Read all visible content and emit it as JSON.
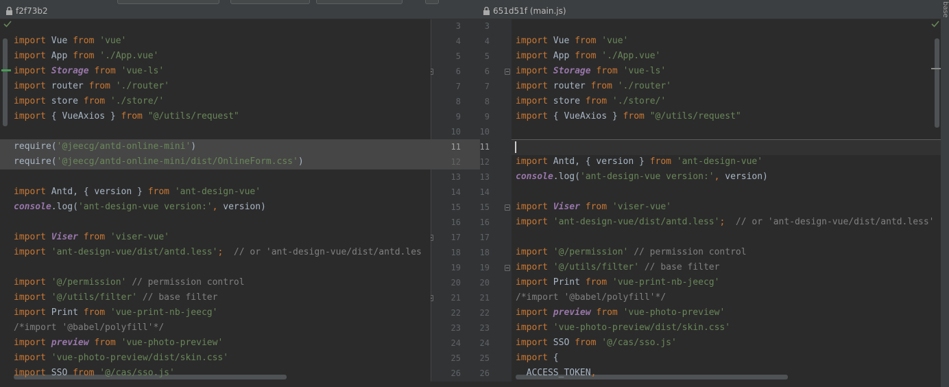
{
  "header": {
    "left_revision": "f2f73b2",
    "right_revision": "651d51f (main.js)",
    "right_edge_label": "base"
  },
  "colors": {
    "keyword": "#cc7832",
    "string": "#6a8759",
    "class": "#9876aa",
    "comment": "#808080",
    "check": "#6a8759",
    "changed_marker": "#499c54"
  },
  "icons": {
    "lock": "lock-icon",
    "check": "check-icon",
    "fold": "fold-marker-icon"
  },
  "left_lines": [
    [
      {
        "t": "kw",
        "v": "import"
      },
      {
        "t": "plain",
        "v": " Vue "
      },
      {
        "t": "kw",
        "v": "from"
      },
      {
        "t": "plain",
        "v": " "
      },
      {
        "t": "str",
        "v": "'vue'"
      }
    ],
    [
      {
        "t": "kw",
        "v": "import"
      },
      {
        "t": "plain",
        "v": " App "
      },
      {
        "t": "kw",
        "v": "from"
      },
      {
        "t": "plain",
        "v": " "
      },
      {
        "t": "str",
        "v": "'./App.vue'"
      }
    ],
    [
      {
        "t": "kw",
        "v": "import"
      },
      {
        "t": "plain",
        "v": " "
      },
      {
        "t": "cls",
        "v": "Storage"
      },
      {
        "t": "plain",
        "v": " "
      },
      {
        "t": "kw",
        "v": "from"
      },
      {
        "t": "plain",
        "v": " "
      },
      {
        "t": "str",
        "v": "'vue-ls'"
      }
    ],
    [
      {
        "t": "kw",
        "v": "import"
      },
      {
        "t": "plain",
        "v": " router "
      },
      {
        "t": "kw",
        "v": "from"
      },
      {
        "t": "plain",
        "v": " "
      },
      {
        "t": "str",
        "v": "'./router'"
      }
    ],
    [
      {
        "t": "kw",
        "v": "import"
      },
      {
        "t": "plain",
        "v": " store "
      },
      {
        "t": "kw",
        "v": "from"
      },
      {
        "t": "plain",
        "v": " "
      },
      {
        "t": "str",
        "v": "'./store/'"
      }
    ],
    [
      {
        "t": "kw",
        "v": "import"
      },
      {
        "t": "plain",
        "v": " { VueAxios } "
      },
      {
        "t": "kw",
        "v": "from"
      },
      {
        "t": "plain",
        "v": " "
      },
      {
        "t": "str",
        "v": "\"@/utils/request\""
      }
    ],
    [],
    [
      {
        "t": "plain",
        "v": "require("
      },
      {
        "t": "str",
        "v": "'@jeecg/antd-online-mini'"
      },
      {
        "t": "plain",
        "v": ")"
      }
    ],
    [
      {
        "t": "plain",
        "v": "require("
      },
      {
        "t": "str",
        "v": "'@jeecg/antd-online-mini/dist/OnlineForm.css'"
      },
      {
        "t": "plain",
        "v": ")"
      }
    ],
    [],
    [
      {
        "t": "kw",
        "v": "import"
      },
      {
        "t": "plain",
        "v": " Antd, { version } "
      },
      {
        "t": "kw",
        "v": "from"
      },
      {
        "t": "plain",
        "v": " "
      },
      {
        "t": "str",
        "v": "'ant-design-vue'"
      }
    ],
    [
      {
        "t": "cls",
        "v": "console"
      },
      {
        "t": "plain",
        "v": "."
      },
      {
        "t": "plain",
        "v": "log("
      },
      {
        "t": "str",
        "v": "'ant-design-vue version:'"
      },
      {
        "t": "kw",
        "v": ","
      },
      {
        "t": "plain",
        "v": " version)"
      }
    ],
    [],
    [
      {
        "t": "kw",
        "v": "import"
      },
      {
        "t": "plain",
        "v": " "
      },
      {
        "t": "cls",
        "v": "Viser"
      },
      {
        "t": "plain",
        "v": " "
      },
      {
        "t": "kw",
        "v": "from"
      },
      {
        "t": "plain",
        "v": " "
      },
      {
        "t": "str",
        "v": "'viser-vue'"
      }
    ],
    [
      {
        "t": "kw",
        "v": "import"
      },
      {
        "t": "plain",
        "v": " "
      },
      {
        "t": "str",
        "v": "'ant-design-vue/dist/antd.less'"
      },
      {
        "t": "kw",
        "v": ";"
      },
      {
        "t": "plain",
        "v": "  "
      },
      {
        "t": "cmt",
        "v": "// or 'ant-design-vue/dist/antd.les"
      }
    ],
    [],
    [
      {
        "t": "kw",
        "v": "import"
      },
      {
        "t": "plain",
        "v": " "
      },
      {
        "t": "str",
        "v": "'@/permission'"
      },
      {
        "t": "plain",
        "v": " "
      },
      {
        "t": "cmt",
        "v": "// permission control"
      }
    ],
    [
      {
        "t": "kw",
        "v": "import"
      },
      {
        "t": "plain",
        "v": " "
      },
      {
        "t": "str",
        "v": "'@/utils/filter'"
      },
      {
        "t": "plain",
        "v": " "
      },
      {
        "t": "cmt",
        "v": "// base filter"
      }
    ],
    [
      {
        "t": "kw",
        "v": "import"
      },
      {
        "t": "plain",
        "v": " Print "
      },
      {
        "t": "kw",
        "v": "from"
      },
      {
        "t": "plain",
        "v": " "
      },
      {
        "t": "str",
        "v": "'vue-print-nb-jeecg'"
      }
    ],
    [
      {
        "t": "cmt",
        "v": "/*import '@babel/polyfill'*/"
      }
    ],
    [
      {
        "t": "kw",
        "v": "import"
      },
      {
        "t": "plain",
        "v": " "
      },
      {
        "t": "cls",
        "v": "preview"
      },
      {
        "t": "plain",
        "v": " "
      },
      {
        "t": "kw",
        "v": "from"
      },
      {
        "t": "plain",
        "v": " "
      },
      {
        "t": "str",
        "v": "'vue-photo-preview'"
      }
    ],
    [
      {
        "t": "kw",
        "v": "import"
      },
      {
        "t": "plain",
        "v": " "
      },
      {
        "t": "str",
        "v": "'vue-photo-preview/dist/skin.css'"
      }
    ],
    [
      {
        "t": "kw",
        "v": "import"
      },
      {
        "t": "plain",
        "v": " SSO "
      },
      {
        "t": "kw",
        "v": "from"
      },
      {
        "t": "plain",
        "v": " "
      },
      {
        "t": "str",
        "v": "'@/cas/sso.js'"
      }
    ]
  ],
  "right_lines": [
    [
      {
        "t": "kw",
        "v": "import"
      },
      {
        "t": "plain",
        "v": " Vue "
      },
      {
        "t": "kw",
        "v": "from"
      },
      {
        "t": "plain",
        "v": " "
      },
      {
        "t": "str",
        "v": "'vue'"
      }
    ],
    [
      {
        "t": "kw",
        "v": "import"
      },
      {
        "t": "plain",
        "v": " App "
      },
      {
        "t": "kw",
        "v": "from"
      },
      {
        "t": "plain",
        "v": " "
      },
      {
        "t": "str",
        "v": "'./App.vue'"
      }
    ],
    [
      {
        "t": "kw",
        "v": "import"
      },
      {
        "t": "plain",
        "v": " "
      },
      {
        "t": "cls",
        "v": "Storage"
      },
      {
        "t": "plain",
        "v": " "
      },
      {
        "t": "kw",
        "v": "from"
      },
      {
        "t": "plain",
        "v": " "
      },
      {
        "t": "str",
        "v": "'vue-ls'"
      }
    ],
    [
      {
        "t": "kw",
        "v": "import"
      },
      {
        "t": "plain",
        "v": " router "
      },
      {
        "t": "kw",
        "v": "from"
      },
      {
        "t": "plain",
        "v": " "
      },
      {
        "t": "str",
        "v": "'./router'"
      }
    ],
    [
      {
        "t": "kw",
        "v": "import"
      },
      {
        "t": "plain",
        "v": " store "
      },
      {
        "t": "kw",
        "v": "from"
      },
      {
        "t": "plain",
        "v": " "
      },
      {
        "t": "str",
        "v": "'./store/'"
      }
    ],
    [
      {
        "t": "kw",
        "v": "import"
      },
      {
        "t": "plain",
        "v": " { VueAxios } "
      },
      {
        "t": "kw",
        "v": "from"
      },
      {
        "t": "plain",
        "v": " "
      },
      {
        "t": "str",
        "v": "\"@/utils/request\""
      }
    ],
    [],
    [],
    [
      {
        "t": "kw",
        "v": "import"
      },
      {
        "t": "plain",
        "v": " Antd, { version } "
      },
      {
        "t": "kw",
        "v": "from"
      },
      {
        "t": "plain",
        "v": " "
      },
      {
        "t": "str",
        "v": "'ant-design-vue'"
      }
    ],
    [
      {
        "t": "cls",
        "v": "console"
      },
      {
        "t": "plain",
        "v": "."
      },
      {
        "t": "plain",
        "v": "log("
      },
      {
        "t": "str",
        "v": "'ant-design-vue version:'"
      },
      {
        "t": "kw",
        "v": ","
      },
      {
        "t": "plain",
        "v": " version)"
      }
    ],
    [],
    [
      {
        "t": "kw",
        "v": "import"
      },
      {
        "t": "plain",
        "v": " "
      },
      {
        "t": "cls",
        "v": "Viser"
      },
      {
        "t": "plain",
        "v": " "
      },
      {
        "t": "kw",
        "v": "from"
      },
      {
        "t": "plain",
        "v": " "
      },
      {
        "t": "str",
        "v": "'viser-vue'"
      }
    ],
    [
      {
        "t": "kw",
        "v": "import"
      },
      {
        "t": "plain",
        "v": " "
      },
      {
        "t": "str",
        "v": "'ant-design-vue/dist/antd.less'"
      },
      {
        "t": "kw",
        "v": ";"
      },
      {
        "t": "plain",
        "v": "  "
      },
      {
        "t": "cmt",
        "v": "// or 'ant-design-vue/dist/antd.less'"
      }
    ],
    [],
    [
      {
        "t": "kw",
        "v": "import"
      },
      {
        "t": "plain",
        "v": " "
      },
      {
        "t": "str",
        "v": "'@/permission'"
      },
      {
        "t": "plain",
        "v": " "
      },
      {
        "t": "cmt",
        "v": "// permission control"
      }
    ],
    [
      {
        "t": "kw",
        "v": "import"
      },
      {
        "t": "plain",
        "v": " "
      },
      {
        "t": "str",
        "v": "'@/utils/filter'"
      },
      {
        "t": "plain",
        "v": " "
      },
      {
        "t": "cmt",
        "v": "// base filter"
      }
    ],
    [
      {
        "t": "kw",
        "v": "import"
      },
      {
        "t": "plain",
        "v": " Print "
      },
      {
        "t": "kw",
        "v": "from"
      },
      {
        "t": "plain",
        "v": " "
      },
      {
        "t": "str",
        "v": "'vue-print-nb-jeecg'"
      }
    ],
    [
      {
        "t": "cmt",
        "v": "/*import '@babel/polyfill'*/"
      }
    ],
    [
      {
        "t": "kw",
        "v": "import"
      },
      {
        "t": "plain",
        "v": " "
      },
      {
        "t": "cls",
        "v": "preview"
      },
      {
        "t": "plain",
        "v": " "
      },
      {
        "t": "kw",
        "v": "from"
      },
      {
        "t": "plain",
        "v": " "
      },
      {
        "t": "str",
        "v": "'vue-photo-preview'"
      }
    ],
    [
      {
        "t": "kw",
        "v": "import"
      },
      {
        "t": "plain",
        "v": " "
      },
      {
        "t": "str",
        "v": "'vue-photo-preview/dist/skin.css'"
      }
    ],
    [
      {
        "t": "kw",
        "v": "import"
      },
      {
        "t": "plain",
        "v": " SSO "
      },
      {
        "t": "kw",
        "v": "from"
      },
      {
        "t": "plain",
        "v": " "
      },
      {
        "t": "str",
        "v": "'@/cas/sso.js'"
      }
    ],
    [
      {
        "t": "kw",
        "v": "import"
      },
      {
        "t": "plain",
        "v": " {"
      }
    ],
    [
      {
        "t": "plain",
        "v": "  ACCESS_TOKEN"
      },
      {
        "t": "kw",
        "v": ","
      }
    ]
  ],
  "gutter_left_numbers": [
    "3",
    "4",
    "5",
    "6",
    "7",
    "8",
    "9",
    "10",
    "11",
    "12",
    "13",
    "14",
    "15",
    "16",
    "17",
    "18",
    "19",
    "20",
    "21",
    "22",
    "23",
    "24",
    "25",
    "26"
  ],
  "gutter_right_numbers": [
    "3",
    "4",
    "5",
    "6",
    "7",
    "8",
    "9",
    "10",
    "11",
    "12",
    "13",
    "14",
    "15",
    "16",
    "17",
    "18",
    "19",
    "20",
    "21",
    "22",
    "23",
    "24",
    "25",
    "26"
  ]
}
